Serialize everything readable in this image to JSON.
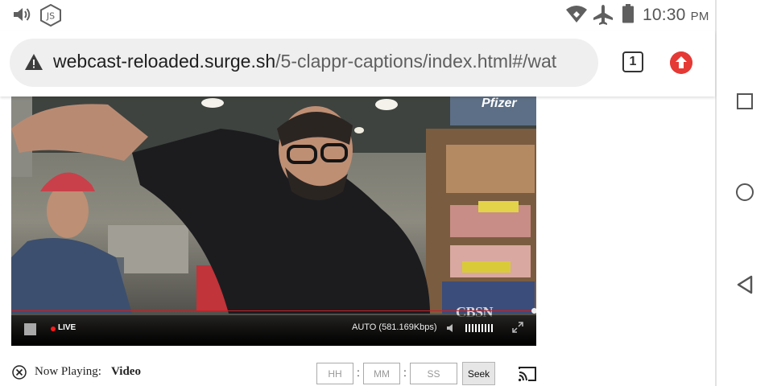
{
  "status_bar": {
    "time": "10:30",
    "ampm": "PM",
    "icons": [
      "volume-icon",
      "js-node-icon",
      "wifi-icon",
      "airplane-mode-icon",
      "battery-icon"
    ]
  },
  "browser": {
    "url_host": "webcast-reloaded.surge.sh",
    "url_path": "/5-clappr-captions/index.html#/wat",
    "tab_count": "1",
    "security_icon": "warning-icon",
    "menu_icon": "update-arrow-icon",
    "update_color": "#e53935"
  },
  "player": {
    "live_label": "LIVE",
    "quality": "AUTO (581.169Kbps)",
    "watermark": "CBSN",
    "corner_logo": "Pfizer",
    "progress_color": "#c0242a",
    "live_color": "#ff1a1a"
  },
  "below_player": {
    "now_playing_label": "Now Playing:",
    "now_playing_value": "Video",
    "hh_placeholder": "HH",
    "mm_placeholder": "MM",
    "ss_placeholder": "SS",
    "separator": ":",
    "seek_label": "Seek"
  },
  "nav_bar": {
    "icons": [
      "recents-square-icon",
      "home-circle-icon",
      "back-triangle-icon"
    ]
  }
}
